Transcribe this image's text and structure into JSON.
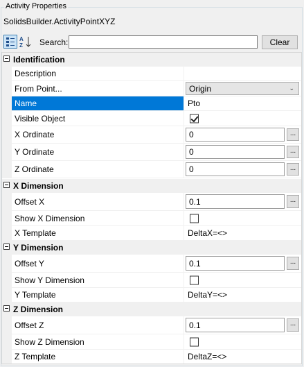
{
  "window": {
    "group_title": "Activity Properties",
    "object_class": "SolidsBuilder.ActivityPointXYZ"
  },
  "toolbar": {
    "categorized_icon": "categorized-icon",
    "alphabetical_icon": "alphabetical-sort-icon",
    "search_label": "Search:",
    "search_value": "",
    "clear_label": "Clear"
  },
  "grid": {
    "identification": {
      "label": "Identification",
      "description": {
        "name": "Description",
        "value": ""
      },
      "from_point": {
        "name": "From Point...",
        "value": "Origin"
      },
      "name": {
        "name": "Name",
        "value": "Pto"
      },
      "visible": {
        "name": "Visible Object",
        "checked": true
      },
      "x_ord": {
        "name": "X Ordinate",
        "value": "0"
      },
      "y_ord": {
        "name": "Y Ordinate",
        "value": "0"
      },
      "z_ord": {
        "name": "Z Ordinate",
        "value": "0"
      }
    },
    "x_dim": {
      "label": "X Dimension",
      "offset": {
        "name": "Offset X",
        "value": "0.1"
      },
      "show": {
        "name": "Show X Dimension",
        "checked": false
      },
      "template": {
        "name": "X Template",
        "value": "DeltaX=<>"
      }
    },
    "y_dim": {
      "label": "Y Dimension",
      "offset": {
        "name": "Offset Y",
        "value": "0.1"
      },
      "show": {
        "name": "Show Y Dimension",
        "checked": false
      },
      "template": {
        "name": "Y Template",
        "value": "DeltaY=<>"
      }
    },
    "z_dim": {
      "label": "Z Dimension",
      "offset": {
        "name": "Offset Z",
        "value": "0.1"
      },
      "show": {
        "name": "Show Z Dimension",
        "checked": false
      },
      "template": {
        "name": "Z Template",
        "value": "DeltaZ=<>"
      }
    },
    "ellipsis_label": "...",
    "colors": {
      "selection": "#0078d7",
      "gutter": "#f0f0f0"
    }
  }
}
